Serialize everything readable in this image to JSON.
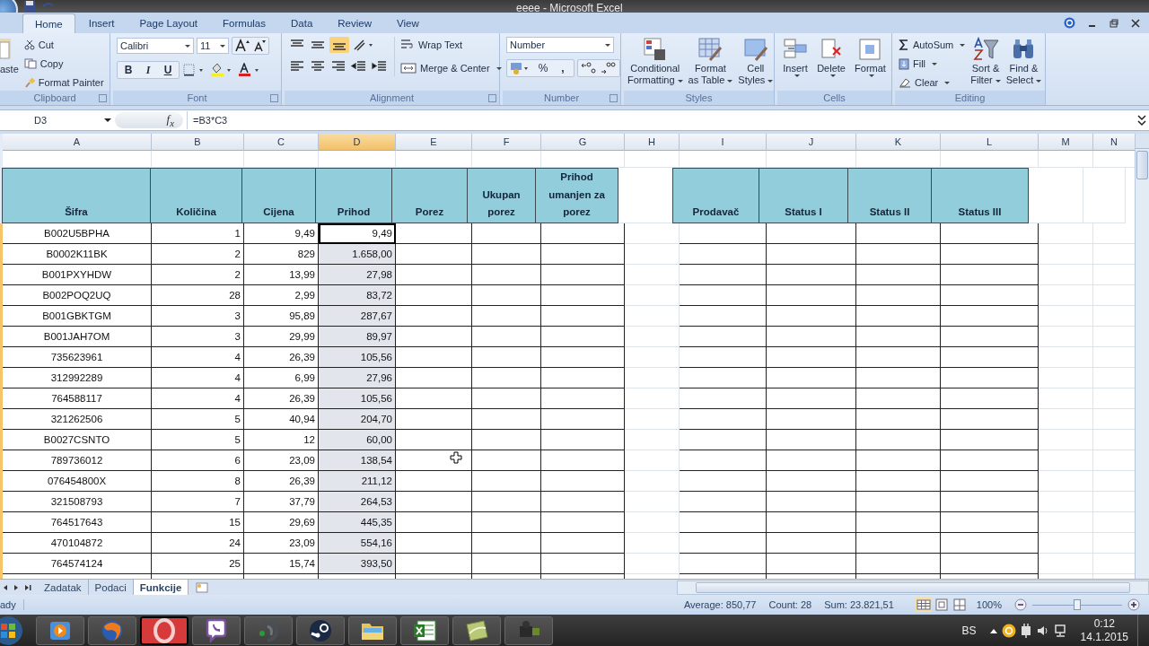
{
  "window": {
    "title": "eeee - Microsoft Excel"
  },
  "ribbon_tabs": [
    {
      "label": "Home",
      "selected": true
    },
    {
      "label": "Insert",
      "selected": false
    },
    {
      "label": "Page Layout",
      "selected": false
    },
    {
      "label": "Formulas",
      "selected": false
    },
    {
      "label": "Data",
      "selected": false
    },
    {
      "label": "Review",
      "selected": false
    },
    {
      "label": "View",
      "selected": false
    }
  ],
  "clipboard": {
    "paste": "aste",
    "cut": "Cut",
    "copy": "Copy",
    "format_painter": "Format Painter",
    "label": "Clipboard"
  },
  "font": {
    "name": "Calibri",
    "size": "11",
    "bold": "B",
    "italic": "I",
    "underline": "U",
    "label": "Font"
  },
  "alignment": {
    "wrap_text": "Wrap Text",
    "merge": "Merge & Center",
    "label": "Alignment"
  },
  "number": {
    "format": "Number",
    "percent": "%",
    "comma": ",",
    "label": "Number"
  },
  "styles": {
    "buttons": [
      {
        "lines": [
          "Conditional",
          "Formatting"
        ],
        "kind": "conditional"
      },
      {
        "lines": [
          "Format",
          "as Table"
        ],
        "kind": "table"
      },
      {
        "lines": [
          "Cell",
          "Styles"
        ],
        "kind": "cellstyle"
      }
    ],
    "label": "Styles"
  },
  "cells": {
    "buttons": [
      {
        "label": "Insert",
        "kind": "insert"
      },
      {
        "label": "Delete",
        "kind": "delete"
      },
      {
        "label": "Format",
        "kind": "format"
      }
    ],
    "label": "Cells"
  },
  "editing": {
    "autosum": "AutoSum",
    "fill": "Fill",
    "clear": "Clear",
    "sort": [
      "Sort &",
      "Filter"
    ],
    "find": [
      "Find &",
      "Select"
    ],
    "label": "Editing"
  },
  "formula_bar": {
    "name_box": "D3",
    "fx": "f$_{x}$",
    "formula": "=B3*C3"
  },
  "columns": [
    {
      "label": "A",
      "selected": false
    },
    {
      "label": "B",
      "selected": false
    },
    {
      "label": "C",
      "selected": false
    },
    {
      "label": "D",
      "selected": true
    },
    {
      "label": "E",
      "selected": false
    },
    {
      "label": "F",
      "selected": false
    },
    {
      "label": "G",
      "selected": false
    },
    {
      "label": "H",
      "selected": false
    },
    {
      "label": "I",
      "selected": false
    },
    {
      "label": "J",
      "selected": false
    },
    {
      "label": "K",
      "selected": false
    },
    {
      "label": "L",
      "selected": false
    },
    {
      "label": "M",
      "selected": false
    },
    {
      "label": "N",
      "selected": false
    }
  ],
  "table": {
    "headers": [
      "Šifra",
      "Količina",
      "Cijena",
      "Prihod",
      "Porez",
      "Ukupan porez",
      "Prihod umanjen za porez"
    ],
    "rows": [
      {
        "cells": [
          "B002U5BPHA",
          "1",
          "9,49",
          "9,49"
        ],
        "active": true
      },
      {
        "cells": [
          "B0002K11BK",
          "2",
          "829",
          "1.658,00"
        ],
        "active": false
      },
      {
        "cells": [
          "B001PXYHDW",
          "2",
          "13,99",
          "27,98"
        ],
        "active": false
      },
      {
        "cells": [
          "B002POQ2UQ",
          "28",
          "2,99",
          "83,72"
        ],
        "active": false
      },
      {
        "cells": [
          "B001GBKTGM",
          "3",
          "95,89",
          "287,67"
        ],
        "active": false
      },
      {
        "cells": [
          "B001JAH7OM",
          "3",
          "29,99",
          "89,97"
        ],
        "active": false
      },
      {
        "cells": [
          "735623961",
          "4",
          "26,39",
          "105,56"
        ],
        "active": false
      },
      {
        "cells": [
          "312992289",
          "4",
          "6,99",
          "27,96"
        ],
        "active": false
      },
      {
        "cells": [
          "764588117",
          "4",
          "26,39",
          "105,56"
        ],
        "active": false
      },
      {
        "cells": [
          "321262506",
          "5",
          "40,94",
          "204,70"
        ],
        "active": false
      },
      {
        "cells": [
          "B0027CSNTO",
          "5",
          "12",
          "60,00"
        ],
        "active": false
      },
      {
        "cells": [
          "789736012",
          "6",
          "23,09",
          "138,54"
        ],
        "active": false
      },
      {
        "cells": [
          "076454800X",
          "8",
          "26,39",
          "211,12"
        ],
        "active": false
      },
      {
        "cells": [
          "321508793",
          "7",
          "37,79",
          "264,53"
        ],
        "active": false
      },
      {
        "cells": [
          "764517643",
          "15",
          "29,69",
          "445,35"
        ],
        "active": false
      },
      {
        "cells": [
          "470104872",
          "24",
          "23,09",
          "554,16"
        ],
        "active": false
      },
      {
        "cells": [
          "764574124",
          "25",
          "15,74",
          "393,50"
        ],
        "active": false
      }
    ]
  },
  "table_right": {
    "headers": [
      "Prodavač",
      "Status I",
      "Status II",
      "Status III"
    ]
  },
  "sheet_tabs": [
    {
      "label": "Zadatak",
      "selected": false
    },
    {
      "label": "Podaci",
      "selected": false
    },
    {
      "label": "Funkcije",
      "selected": true
    }
  ],
  "status_bar": {
    "mode": "ady",
    "average": "Average: 850,77",
    "count": "Count: 28",
    "sum": "Sum: 23.821,51",
    "zoom": "100%",
    "level": 0.5
  },
  "taskbar": {
    "apps": [
      {
        "kind": "media",
        "active": false
      },
      {
        "kind": "globe",
        "active": false
      },
      {
        "kind": "ring",
        "active": true
      },
      {
        "kind": "phone",
        "active": false
      },
      {
        "kind": "headset",
        "active": false
      },
      {
        "kind": "steam",
        "active": false
      },
      {
        "kind": "folder",
        "active": false
      },
      {
        "kind": "sheet",
        "active": false
      },
      {
        "kind": "leaf",
        "active": false
      },
      {
        "kind": "camera",
        "active": false
      }
    ],
    "language": "BS",
    "time": "0:12",
    "date": "14.1.2015"
  }
}
